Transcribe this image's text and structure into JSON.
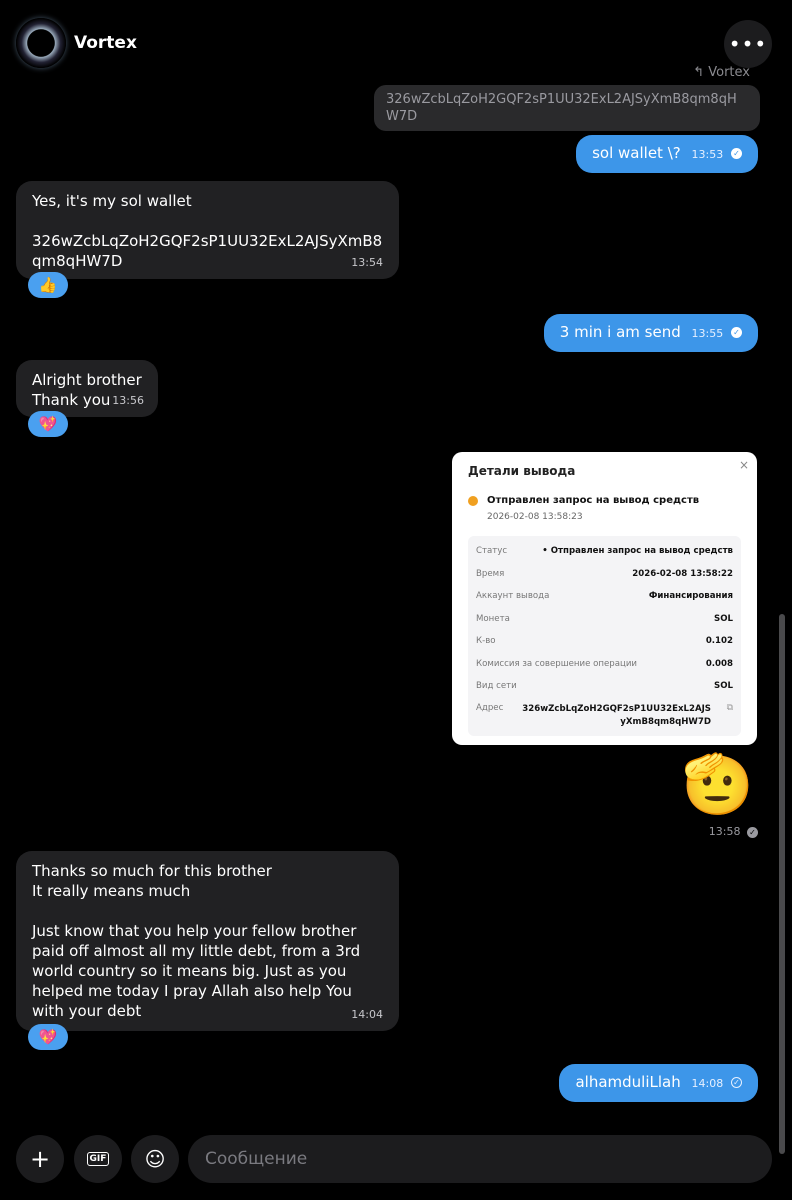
{
  "header": {
    "title": "Vortex",
    "menu_icon": "more-horizontal-icon"
  },
  "reply": {
    "label": "↰ Vortex",
    "text": "326wZcbLqZoH2GQF2sP1UU32ExL2AJSyXmB8qm8qHW7D"
  },
  "messages": {
    "m1": {
      "text": "sol wallet \\?",
      "time": "13:53"
    },
    "m2": {
      "text": "Yes, it's my sol wallet\n\n326wZcbLqZoH2GQF2sP1UU32ExL2AJSyXmB8qm8qHW7D",
      "time": "13:54",
      "reaction": "👍"
    },
    "m3": {
      "text": "3 min i am send",
      "time": "13:55"
    },
    "m4": {
      "text": "Alright brother\nThank you",
      "time": "13:56",
      "reaction": "💖"
    },
    "m5": {
      "emoji": "🫡",
      "time": "13:58"
    },
    "m6": {
      "text": "Thanks so much for this brother\nIt really means much\n\nJust know that you help your fellow brother paid off almost all my little debt, from a 3rd world country so it means big. Just as you helped me today I pray Allah also help You with your debt",
      "time": "14:04",
      "reaction": "💖"
    },
    "m7": {
      "text": "alhamduliLlah",
      "time": "14:08"
    }
  },
  "card": {
    "title": "Детали вывода",
    "close": "×",
    "status_title": "Отправлен запрос на вывод средств",
    "status_time": "2026-02-08 13:58:23",
    "rows": [
      {
        "k": "Статус",
        "v": "• Отправлен запрос на вывод средств"
      },
      {
        "k": "Время",
        "v": "2026-02-08 13:58:22"
      },
      {
        "k": "Аккаунт вывода",
        "v": "Финансирования"
      },
      {
        "k": "Монета",
        "v": "SOL"
      },
      {
        "k": "К-во",
        "v": "0.102"
      },
      {
        "k": "Комиссия за совершение операции",
        "v": "0.008"
      },
      {
        "k": "Вид сети",
        "v": "SOL"
      },
      {
        "k": "Адрес",
        "v": "326wZcbLqZoH2GQF2sP1UU32ExL2AJS\nyXmB8qm8qHW7D"
      }
    ]
  },
  "composer": {
    "placeholder": "Сообщение",
    "gif_label": "GIF"
  }
}
